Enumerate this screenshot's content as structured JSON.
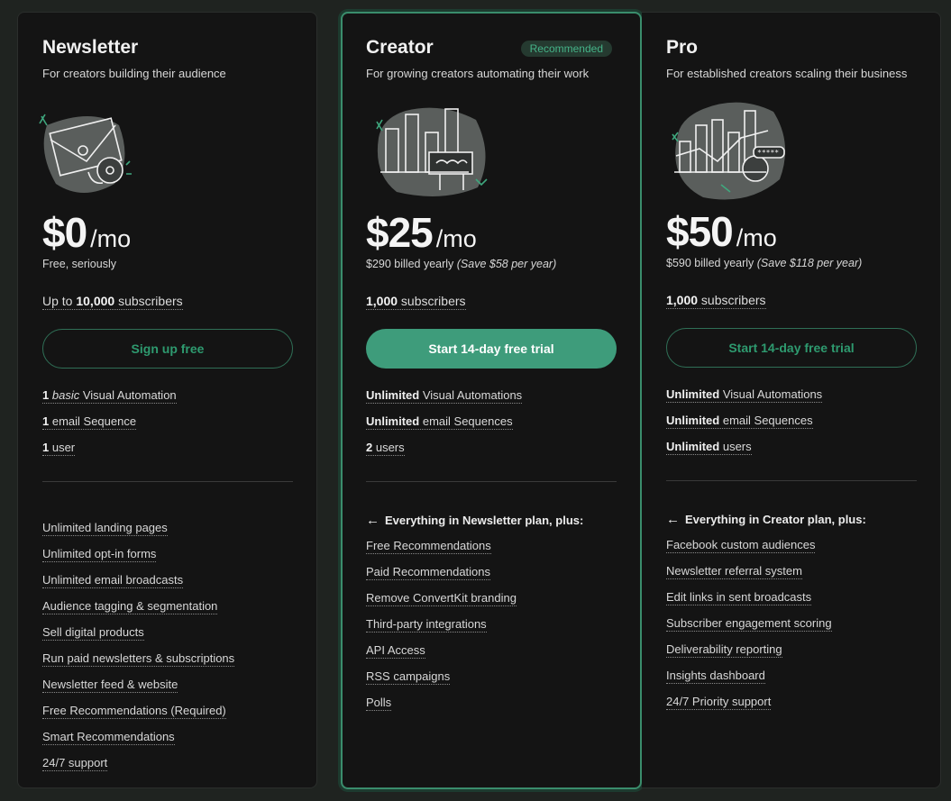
{
  "plans": [
    {
      "title": "Newsletter",
      "subtitle": "For creators building their audience",
      "price": "$0",
      "per": "/mo",
      "billing": "Free, seriously",
      "billing_save": "",
      "subs_prefix": "Up to ",
      "subs_bold": "10,000",
      "subs_suffix": " subscribers",
      "cta": "Sign up free",
      "features": [
        {
          "bold": "1",
          "italic": "basic",
          "text": " Visual Automation"
        },
        {
          "bold": "1",
          "italic": "",
          "text": " email Sequence"
        },
        {
          "bold": "1",
          "italic": "",
          "text": " user"
        }
      ],
      "extras_head": "",
      "extras": [
        "Unlimited landing pages",
        "Unlimited opt-in forms",
        "Unlimited email broadcasts",
        "Audience tagging & segmentation",
        "Sell digital products",
        "Run paid newsletters & subscriptions",
        "Newsletter feed & website",
        "Free Recommendations (Required)",
        "Smart Recommendations",
        "24/7 support"
      ]
    },
    {
      "title": "Creator",
      "badge": "Recommended",
      "subtitle": "For growing creators automating their work",
      "price": "$25",
      "per": "/mo",
      "billing": "$290 billed yearly ",
      "billing_save": "(Save $58 per year)",
      "subs_prefix": "",
      "subs_bold": "1,000",
      "subs_suffix": " subscribers",
      "cta": "Start 14-day free trial",
      "features": [
        {
          "bold": "Unlimited",
          "italic": "",
          "text": " Visual Automations"
        },
        {
          "bold": "Unlimited",
          "italic": "",
          "text": " email Sequences"
        },
        {
          "bold": "2",
          "italic": "",
          "text": " users"
        }
      ],
      "extras_head": "Everything in Newsletter plan, plus:",
      "extras": [
        "Free Recommendations",
        "Paid Recommendations",
        "Remove ConvertKit branding",
        "Third-party integrations",
        "API Access",
        "RSS campaigns",
        "Polls"
      ]
    },
    {
      "title": "Pro",
      "subtitle": "For established creators scaling their business",
      "price": "$50",
      "per": "/mo",
      "billing": "$590 billed yearly ",
      "billing_save": "(Save $118 per year)",
      "subs_prefix": "",
      "subs_bold": "1,000",
      "subs_suffix": " subscribers",
      "cta": "Start 14-day free trial",
      "features": [
        {
          "bold": "Unlimited",
          "italic": "",
          "text": " Visual Automations"
        },
        {
          "bold": "Unlimited",
          "italic": "",
          "text": " email Sequences"
        },
        {
          "bold": "Unlimited",
          "italic": "",
          "text": " users"
        }
      ],
      "extras_head": "Everything in Creator plan, plus:",
      "extras": [
        "Facebook custom audiences",
        "Newsletter referral system",
        "Edit links in sent broadcasts",
        "Subscriber engagement scoring",
        "Deliverability reporting",
        "Insights dashboard",
        "24/7 Priority support"
      ]
    }
  ],
  "colors": {
    "accent": "#3e9c7b",
    "accent_text": "#2e9a6f",
    "card_bg": "#141414",
    "page_bg": "#1f2320"
  },
  "icons": [
    "envelope-illustration",
    "bar-chart-illustration",
    "growth-chart-illustration",
    "arrow-left-icon"
  ]
}
